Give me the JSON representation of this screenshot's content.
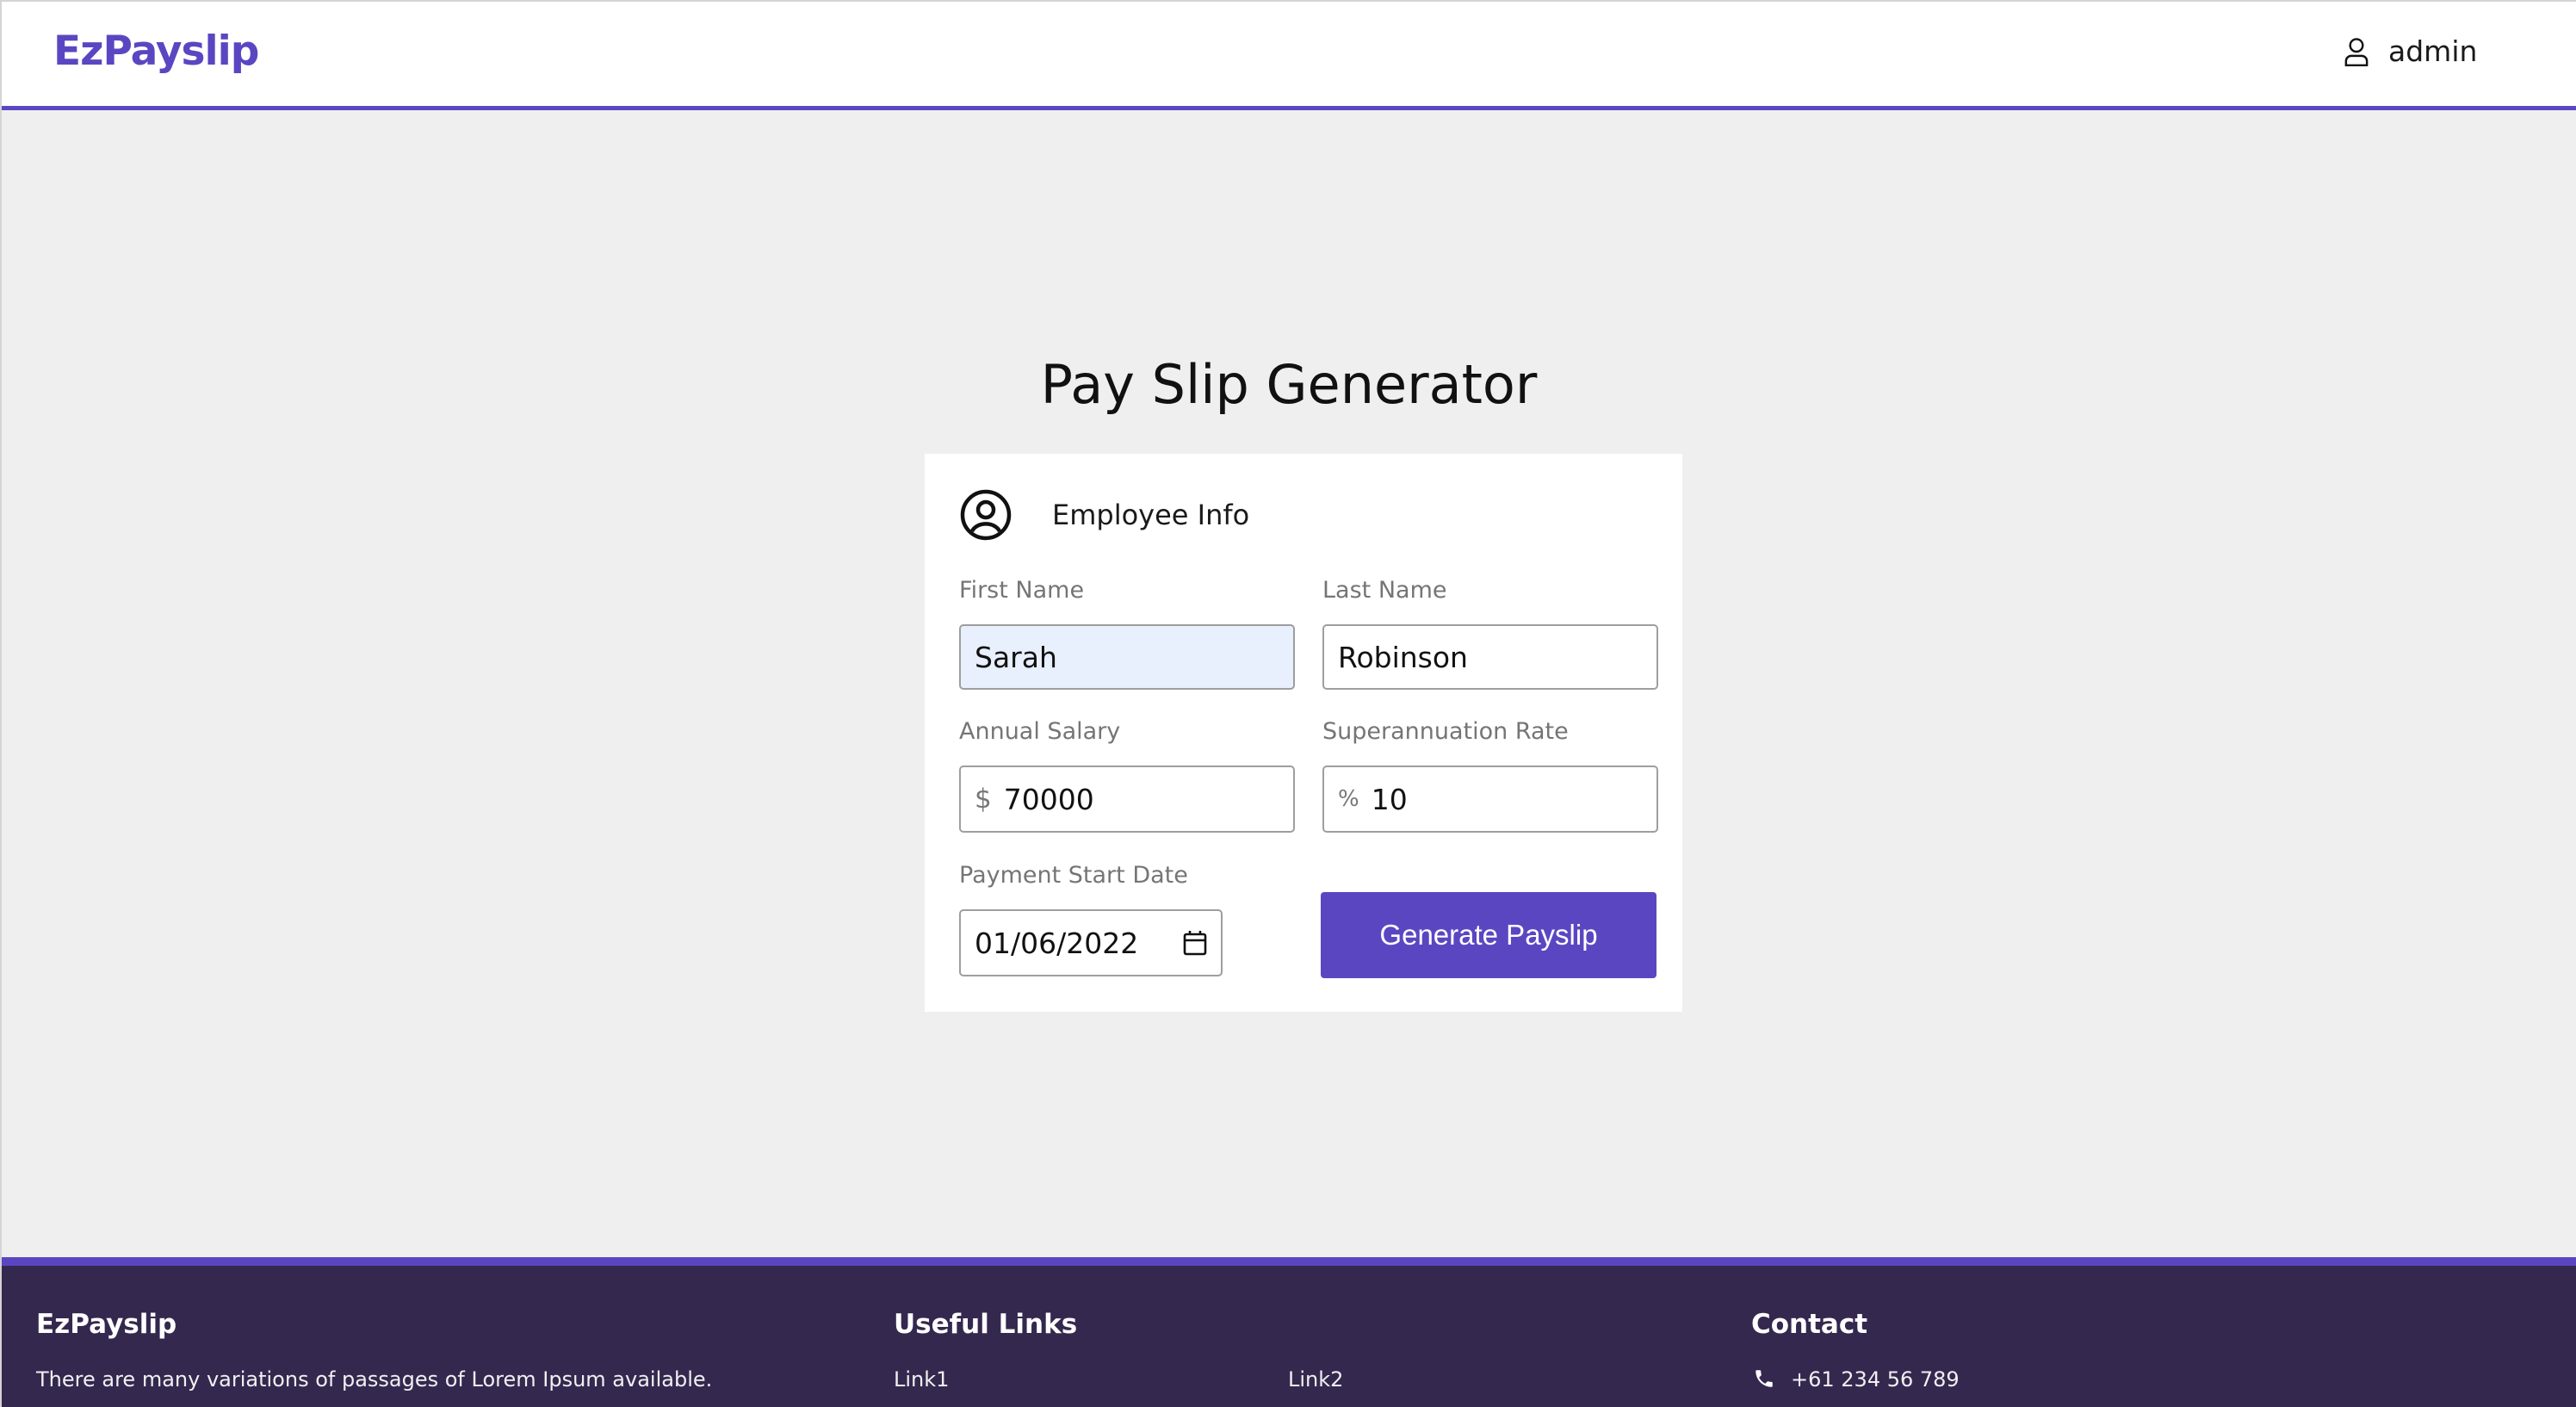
{
  "header": {
    "brand": "EzPayslip",
    "user_icon": "user-icon",
    "username": "admin"
  },
  "main": {
    "title": "Pay Slip Generator",
    "section_title": "Employee Info",
    "section_icon": "user-circle-icon"
  },
  "form": {
    "first_name": {
      "label": "First Name",
      "value": "Sarah"
    },
    "last_name": {
      "label": "Last Name",
      "value": "Robinson"
    },
    "annual_salary": {
      "label": "Annual Salary",
      "prefix": "$",
      "value": "70000"
    },
    "super_rate": {
      "label": "Superannuation Rate",
      "prefix": "%",
      "value": "10"
    },
    "start_date": {
      "label": "Payment Start Date",
      "value": "01/06/2022"
    },
    "submit_label": "Generate Payslip"
  },
  "footer": {
    "brand": "EzPayslip",
    "tagline": "There are many variations of passages of Lorem Ipsum available.",
    "links_title": "Useful Links",
    "link1": "Link1",
    "link2": "Link2",
    "contact_title": "Contact",
    "phone": "+61 234 56 789",
    "phone_icon": "phone-icon"
  },
  "colors": {
    "accent": "#5b46c2",
    "footer_bg": "#35284f",
    "page_bg": "#efefef"
  }
}
